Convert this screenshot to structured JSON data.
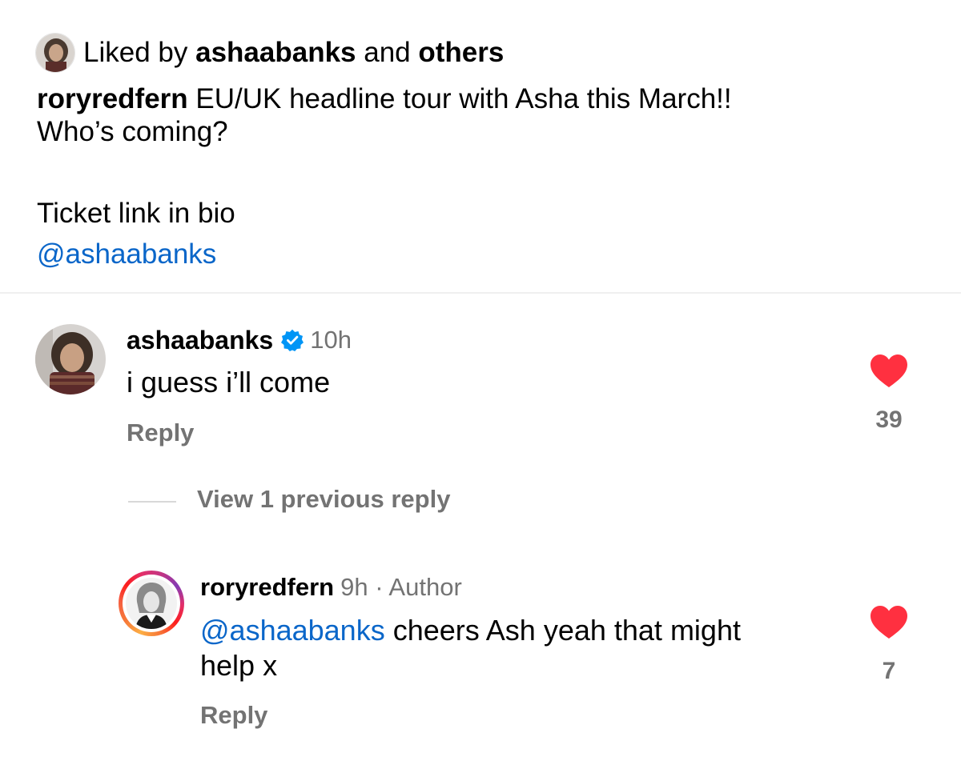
{
  "post": {
    "liked_by": {
      "prefix": "Liked by",
      "user": "ashaabanks",
      "connector": "and",
      "others": "others"
    },
    "caption": {
      "author": "roryredfern",
      "line1_text": "EU/UK headline tour with Asha this March!!",
      "line2_text": "Who’s coming?",
      "line3_text": "Ticket link in bio",
      "mention": "@ashaabanks"
    }
  },
  "comments": [
    {
      "username": "ashaabanks",
      "verified": true,
      "time": "10h",
      "text": "i guess i’ll come",
      "reply_label": "Reply",
      "liked": true,
      "like_count": "39",
      "view_replies_label": "View 1 previous reply"
    }
  ],
  "reply": {
    "username": "roryredfern",
    "time_author": "9h · Author",
    "mention": "@ashaabanks",
    "text_line1": "cheers Ash yeah that might",
    "text_line2": "help x",
    "reply_label": "Reply",
    "liked": true,
    "like_count": "7"
  },
  "colors": {
    "like_red": "#ff3040",
    "link_blue": "#0a66c9",
    "muted_gray": "#737373",
    "verified_blue": "#0095f6"
  },
  "icons": {
    "like": "heart-filled-icon",
    "verified": "verified-badge-icon"
  }
}
